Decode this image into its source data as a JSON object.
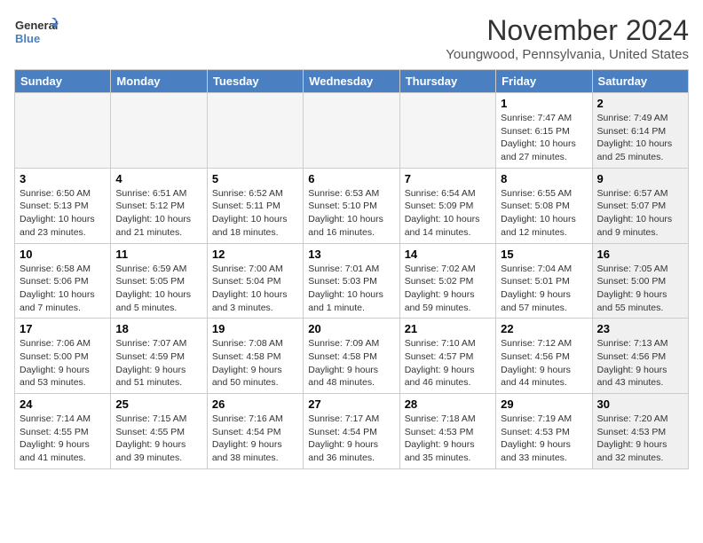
{
  "header": {
    "logo_line1": "General",
    "logo_line2": "Blue",
    "month": "November 2024",
    "location": "Youngwood, Pennsylvania, United States"
  },
  "weekdays": [
    "Sunday",
    "Monday",
    "Tuesday",
    "Wednesday",
    "Thursday",
    "Friday",
    "Saturday"
  ],
  "weeks": [
    [
      {
        "day": "",
        "info": "",
        "shaded": false,
        "empty": true
      },
      {
        "day": "",
        "info": "",
        "shaded": false,
        "empty": true
      },
      {
        "day": "",
        "info": "",
        "shaded": false,
        "empty": true
      },
      {
        "day": "",
        "info": "",
        "shaded": false,
        "empty": true
      },
      {
        "day": "",
        "info": "",
        "shaded": false,
        "empty": true
      },
      {
        "day": "1",
        "info": "Sunrise: 7:47 AM\nSunset: 6:15 PM\nDaylight: 10 hours and 27 minutes.",
        "shaded": false,
        "empty": false
      },
      {
        "day": "2",
        "info": "Sunrise: 7:49 AM\nSunset: 6:14 PM\nDaylight: 10 hours and 25 minutes.",
        "shaded": true,
        "empty": false
      }
    ],
    [
      {
        "day": "3",
        "info": "Sunrise: 6:50 AM\nSunset: 5:13 PM\nDaylight: 10 hours and 23 minutes.",
        "shaded": false,
        "empty": false
      },
      {
        "day": "4",
        "info": "Sunrise: 6:51 AM\nSunset: 5:12 PM\nDaylight: 10 hours and 21 minutes.",
        "shaded": false,
        "empty": false
      },
      {
        "day": "5",
        "info": "Sunrise: 6:52 AM\nSunset: 5:11 PM\nDaylight: 10 hours and 18 minutes.",
        "shaded": false,
        "empty": false
      },
      {
        "day": "6",
        "info": "Sunrise: 6:53 AM\nSunset: 5:10 PM\nDaylight: 10 hours and 16 minutes.",
        "shaded": false,
        "empty": false
      },
      {
        "day": "7",
        "info": "Sunrise: 6:54 AM\nSunset: 5:09 PM\nDaylight: 10 hours and 14 minutes.",
        "shaded": false,
        "empty": false
      },
      {
        "day": "8",
        "info": "Sunrise: 6:55 AM\nSunset: 5:08 PM\nDaylight: 10 hours and 12 minutes.",
        "shaded": false,
        "empty": false
      },
      {
        "day": "9",
        "info": "Sunrise: 6:57 AM\nSunset: 5:07 PM\nDaylight: 10 hours and 9 minutes.",
        "shaded": true,
        "empty": false
      }
    ],
    [
      {
        "day": "10",
        "info": "Sunrise: 6:58 AM\nSunset: 5:06 PM\nDaylight: 10 hours and 7 minutes.",
        "shaded": false,
        "empty": false
      },
      {
        "day": "11",
        "info": "Sunrise: 6:59 AM\nSunset: 5:05 PM\nDaylight: 10 hours and 5 minutes.",
        "shaded": false,
        "empty": false
      },
      {
        "day": "12",
        "info": "Sunrise: 7:00 AM\nSunset: 5:04 PM\nDaylight: 10 hours and 3 minutes.",
        "shaded": false,
        "empty": false
      },
      {
        "day": "13",
        "info": "Sunrise: 7:01 AM\nSunset: 5:03 PM\nDaylight: 10 hours and 1 minute.",
        "shaded": false,
        "empty": false
      },
      {
        "day": "14",
        "info": "Sunrise: 7:02 AM\nSunset: 5:02 PM\nDaylight: 9 hours and 59 minutes.",
        "shaded": false,
        "empty": false
      },
      {
        "day": "15",
        "info": "Sunrise: 7:04 AM\nSunset: 5:01 PM\nDaylight: 9 hours and 57 minutes.",
        "shaded": false,
        "empty": false
      },
      {
        "day": "16",
        "info": "Sunrise: 7:05 AM\nSunset: 5:00 PM\nDaylight: 9 hours and 55 minutes.",
        "shaded": true,
        "empty": false
      }
    ],
    [
      {
        "day": "17",
        "info": "Sunrise: 7:06 AM\nSunset: 5:00 PM\nDaylight: 9 hours and 53 minutes.",
        "shaded": false,
        "empty": false
      },
      {
        "day": "18",
        "info": "Sunrise: 7:07 AM\nSunset: 4:59 PM\nDaylight: 9 hours and 51 minutes.",
        "shaded": false,
        "empty": false
      },
      {
        "day": "19",
        "info": "Sunrise: 7:08 AM\nSunset: 4:58 PM\nDaylight: 9 hours and 50 minutes.",
        "shaded": false,
        "empty": false
      },
      {
        "day": "20",
        "info": "Sunrise: 7:09 AM\nSunset: 4:58 PM\nDaylight: 9 hours and 48 minutes.",
        "shaded": false,
        "empty": false
      },
      {
        "day": "21",
        "info": "Sunrise: 7:10 AM\nSunset: 4:57 PM\nDaylight: 9 hours and 46 minutes.",
        "shaded": false,
        "empty": false
      },
      {
        "day": "22",
        "info": "Sunrise: 7:12 AM\nSunset: 4:56 PM\nDaylight: 9 hours and 44 minutes.",
        "shaded": false,
        "empty": false
      },
      {
        "day": "23",
        "info": "Sunrise: 7:13 AM\nSunset: 4:56 PM\nDaylight: 9 hours and 43 minutes.",
        "shaded": true,
        "empty": false
      }
    ],
    [
      {
        "day": "24",
        "info": "Sunrise: 7:14 AM\nSunset: 4:55 PM\nDaylight: 9 hours and 41 minutes.",
        "shaded": false,
        "empty": false
      },
      {
        "day": "25",
        "info": "Sunrise: 7:15 AM\nSunset: 4:55 PM\nDaylight: 9 hours and 39 minutes.",
        "shaded": false,
        "empty": false
      },
      {
        "day": "26",
        "info": "Sunrise: 7:16 AM\nSunset: 4:54 PM\nDaylight: 9 hours and 38 minutes.",
        "shaded": false,
        "empty": false
      },
      {
        "day": "27",
        "info": "Sunrise: 7:17 AM\nSunset: 4:54 PM\nDaylight: 9 hours and 36 minutes.",
        "shaded": false,
        "empty": false
      },
      {
        "day": "28",
        "info": "Sunrise: 7:18 AM\nSunset: 4:53 PM\nDaylight: 9 hours and 35 minutes.",
        "shaded": false,
        "empty": false
      },
      {
        "day": "29",
        "info": "Sunrise: 7:19 AM\nSunset: 4:53 PM\nDaylight: 9 hours and 33 minutes.",
        "shaded": false,
        "empty": false
      },
      {
        "day": "30",
        "info": "Sunrise: 7:20 AM\nSunset: 4:53 PM\nDaylight: 9 hours and 32 minutes.",
        "shaded": true,
        "empty": false
      }
    ]
  ]
}
